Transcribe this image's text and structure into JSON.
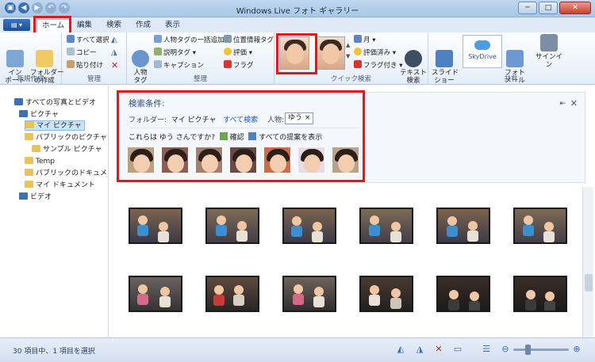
{
  "window": {
    "title": "Windows Live フォト ギャラリー",
    "controls": {
      "minimize": "─",
      "maximize": "□",
      "close": "✕"
    }
  },
  "tabs": [
    {
      "label": "ホーム",
      "active": true
    },
    {
      "label": "編集"
    },
    {
      "label": "検索"
    },
    {
      "label": "作成"
    },
    {
      "label": "表示"
    }
  ],
  "ribbon": {
    "groups": {
      "new": "新規作成",
      "manage": "管理",
      "organize": "整理",
      "quick_search": "クイック検索",
      "share": "共有"
    },
    "import": "イン\nポート",
    "new_folder": "フォルダー\nの作成",
    "select_all": "すべて選択",
    "copy": "コピー",
    "paste": "貼り付け",
    "people_tag": "人物\nタグ",
    "batch_people_tag": "人物タグの一括追加",
    "caption_tag": "説明タグ",
    "caption": "キャプション",
    "geotag": "位置情報タグ",
    "rating": "評価",
    "flag": "フラグ",
    "month": "月",
    "rated": "評価済み",
    "flagged": "フラグ付き",
    "text_search": "テキスト\n検索",
    "slideshow": "スライド\nショー",
    "skydrive": "SkyDrive",
    "photo_mail": "フォト\nメール",
    "sign_in": "サインイン"
  },
  "nav": {
    "items": [
      {
        "label": "すべての写真とビデオ",
        "level": 0
      },
      {
        "label": "ピクチャ",
        "level": 1
      },
      {
        "label": "マイ ピクチャ",
        "level": 2,
        "selected": true
      },
      {
        "label": "パブリックのピクチャ",
        "level": 2
      },
      {
        "label": "サンプル ピクチャ",
        "level": 3
      },
      {
        "label": "Temp",
        "level": 2
      },
      {
        "label": "パブリックのドキュメ",
        "level": 2
      },
      {
        "label": "マイ ドキュメント",
        "level": 2
      },
      {
        "label": "ビデオ",
        "level": 1
      }
    ]
  },
  "search": {
    "title": "検索条件:",
    "folder_label": "フォルダー:",
    "folder_value": "マイ ピクチャ",
    "search_all": "すべて検索",
    "person_label": "人物:",
    "person_token": "ゆう",
    "question": "これらは ゆう さんですか?",
    "confirm": "確認",
    "show_all_suggestions": "すべての提案を表示",
    "pin_icon": "⇤",
    "close_icon": "✕"
  },
  "status": {
    "text": "30 項目中、1 項目を選択",
    "zoom_fraction": 0.25
  }
}
